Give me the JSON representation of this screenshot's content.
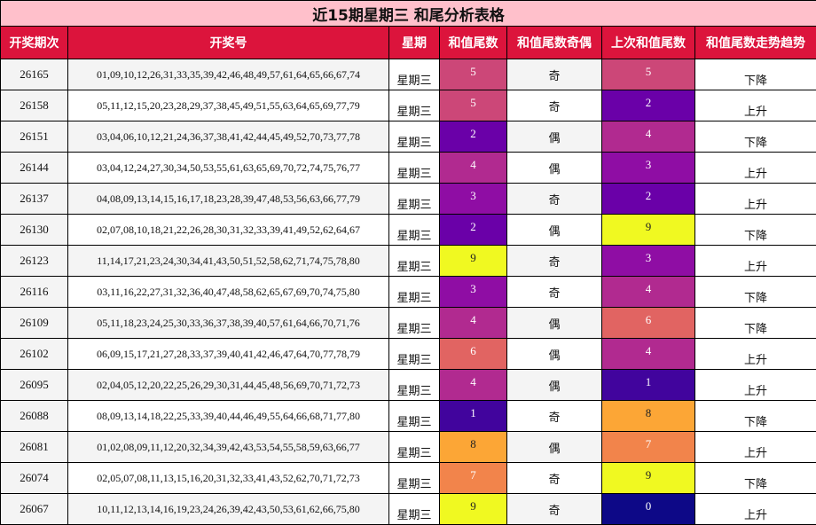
{
  "title": "近15期星期三 和尾分析表格",
  "headers": [
    "开奖期次",
    "开奖号",
    "星期",
    "和值尾数",
    "和值尾数奇偶",
    "上次和值尾数",
    "和值尾数走势趋势"
  ],
  "colors": {
    "title_bg": "#ffc0cb",
    "header_bg": "#dc143c",
    "tail_0": "#0d0887",
    "tail_1": "#41049d",
    "tail_2": "#6a00a8",
    "tail_3": "#8f0da4",
    "tail_4": "#b12a90",
    "tail_5": "#cc4778",
    "tail_6": "#e16462",
    "tail_7": "#f2844b",
    "tail_8": "#fca636",
    "tail_9": "#f0f921"
  },
  "rows": [
    {
      "issue": "26165",
      "numbers": "01,09,10,12,26,31,33,35,39,42,46,48,49,57,61,64,65,66,67,74",
      "weekday": "星期三",
      "tail": "5",
      "parity": "奇",
      "prev_tail": "5",
      "trend": "下降"
    },
    {
      "issue": "26158",
      "numbers": "05,11,12,15,20,23,28,29,37,38,45,49,51,55,63,64,65,69,77,79",
      "weekday": "星期三",
      "tail": "5",
      "parity": "奇",
      "prev_tail": "2",
      "trend": "上升"
    },
    {
      "issue": "26151",
      "numbers": "03,04,06,10,12,21,24,36,37,38,41,42,44,45,49,52,70,73,77,78",
      "weekday": "星期三",
      "tail": "2",
      "parity": "偶",
      "prev_tail": "4",
      "trend": "下降"
    },
    {
      "issue": "26144",
      "numbers": "03,04,12,24,27,30,34,50,53,55,61,63,65,69,70,72,74,75,76,77",
      "weekday": "星期三",
      "tail": "4",
      "parity": "偶",
      "prev_tail": "3",
      "trend": "上升"
    },
    {
      "issue": "26137",
      "numbers": "04,08,09,13,14,15,16,17,18,23,28,39,47,48,53,56,63,66,77,79",
      "weekday": "星期三",
      "tail": "3",
      "parity": "奇",
      "prev_tail": "2",
      "trend": "上升"
    },
    {
      "issue": "26130",
      "numbers": "02,07,08,10,18,21,22,26,28,30,31,32,33,39,41,49,52,62,64,67",
      "weekday": "星期三",
      "tail": "2",
      "parity": "偶",
      "prev_tail": "9",
      "trend": "下降"
    },
    {
      "issue": "26123",
      "numbers": "11,14,17,21,23,24,30,34,41,43,50,51,52,58,62,71,74,75,78,80",
      "weekday": "星期三",
      "tail": "9",
      "parity": "奇",
      "prev_tail": "3",
      "trend": "上升"
    },
    {
      "issue": "26116",
      "numbers": "03,11,16,22,27,31,32,36,40,47,48,58,62,65,67,69,70,74,75,80",
      "weekday": "星期三",
      "tail": "3",
      "parity": "奇",
      "prev_tail": "4",
      "trend": "下降"
    },
    {
      "issue": "26109",
      "numbers": "05,11,18,23,24,25,30,33,36,37,38,39,40,57,61,64,66,70,71,76",
      "weekday": "星期三",
      "tail": "4",
      "parity": "偶",
      "prev_tail": "6",
      "trend": "下降"
    },
    {
      "issue": "26102",
      "numbers": "06,09,15,17,21,27,28,33,37,39,40,41,42,46,47,64,70,77,78,79",
      "weekday": "星期三",
      "tail": "6",
      "parity": "偶",
      "prev_tail": "4",
      "trend": "上升"
    },
    {
      "issue": "26095",
      "numbers": "02,04,05,12,20,22,25,26,29,30,31,44,45,48,56,69,70,71,72,73",
      "weekday": "星期三",
      "tail": "4",
      "parity": "偶",
      "prev_tail": "1",
      "trend": "上升"
    },
    {
      "issue": "26088",
      "numbers": "08,09,13,14,18,22,25,33,39,40,44,46,49,55,64,66,68,71,77,80",
      "weekday": "星期三",
      "tail": "1",
      "parity": "奇",
      "prev_tail": "8",
      "trend": "下降"
    },
    {
      "issue": "26081",
      "numbers": "01,02,08,09,11,12,20,32,34,39,42,43,53,54,55,58,59,63,66,77",
      "weekday": "星期三",
      "tail": "8",
      "parity": "偶",
      "prev_tail": "7",
      "trend": "上升"
    },
    {
      "issue": "26074",
      "numbers": "02,05,07,08,11,13,15,16,20,31,32,33,41,43,52,62,70,71,72,73",
      "weekday": "星期三",
      "tail": "7",
      "parity": "奇",
      "prev_tail": "9",
      "trend": "下降"
    },
    {
      "issue": "26067",
      "numbers": "10,11,12,13,14,16,19,23,24,26,39,42,43,50,53,61,62,66,75,80",
      "weekday": "星期三",
      "tail": "9",
      "parity": "奇",
      "prev_tail": "0",
      "trend": "上升"
    }
  ]
}
